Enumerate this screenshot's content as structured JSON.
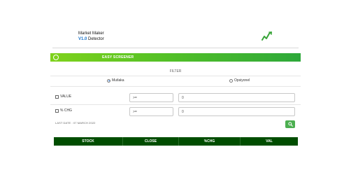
{
  "header": {
    "app_name": "Market Maker",
    "version": "V1.0",
    "subtitle": "Detector"
  },
  "banner": {
    "title": "EASY SCREENER"
  },
  "filter": {
    "label": "FILTER",
    "radio_options": [
      {
        "label": "Mutlaka",
        "selected": true
      },
      {
        "label": "Opsiyonel",
        "selected": false
      }
    ],
    "rows": [
      {
        "label": "VALUE",
        "checked": false,
        "operator": ">=",
        "value": "0"
      },
      {
        "label": "% CHG",
        "checked": false,
        "operator": ">=",
        "value": "0"
      }
    ]
  },
  "last_date": "LAST DATE : 07 MARCH 2022",
  "table": {
    "columns": [
      "STOCK",
      "CLOSE",
      "%CHG",
      "VAL"
    ]
  },
  "colors": {
    "banner_start": "#7fd21c",
    "banner_end": "#2da83a",
    "table_header": "#004d00",
    "search_button": "#4caf50",
    "version": "#1a73c9"
  }
}
